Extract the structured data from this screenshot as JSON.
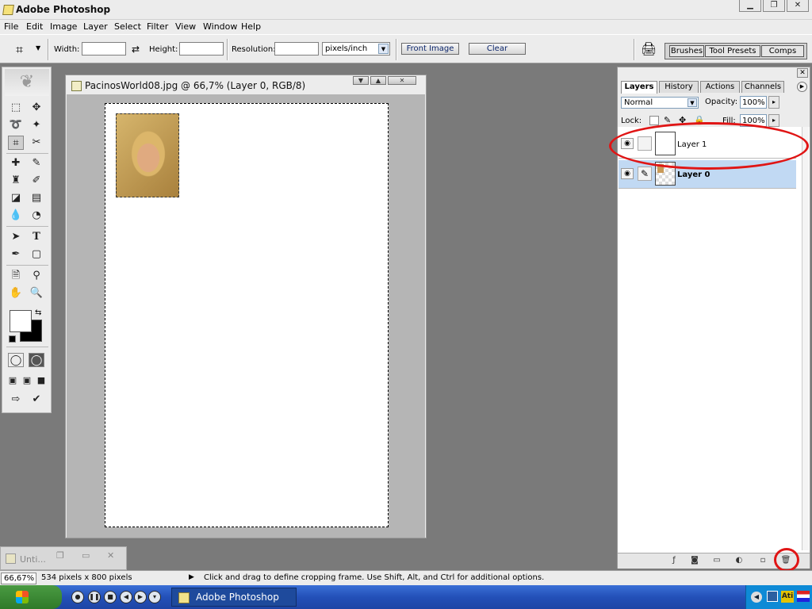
{
  "window": {
    "title": "Adobe Photoshop"
  },
  "menu": [
    "File",
    "Edit",
    "Image",
    "Layer",
    "Select",
    "Filter",
    "View",
    "Window",
    "Help"
  ],
  "options": {
    "width_label": "Width:",
    "width_value": "",
    "height_label": "Height:",
    "height_value": "",
    "resolution_label": "Resolution:",
    "resolution_value": "",
    "units": "pixels/inch",
    "front_image_label": "Front Image",
    "clear_label": "Clear",
    "well_tabs": [
      "Brushes",
      "Tool Presets",
      "Comps"
    ]
  },
  "document": {
    "title": "PacinosWorld08.jpg @ 66,7% (Layer 0, RGB/8)"
  },
  "minimized_doc": {
    "title": "Unti..."
  },
  "panel": {
    "tabs": [
      "Layers",
      "History",
      "Actions",
      "Channels"
    ],
    "active_tab": "Layers",
    "blend_mode": "Normal",
    "opacity_label": "Opacity:",
    "opacity_value": "100%",
    "lock_label": "Lock:",
    "fill_label": "Fill:",
    "fill_value": "100%",
    "layers": [
      {
        "name": "Layer 1",
        "visible": true,
        "selected": false
      },
      {
        "name": "Layer 0",
        "visible": true,
        "selected": true
      }
    ]
  },
  "status": {
    "zoom": "66,67%",
    "doc_info": "534 pixels x 800 pixels",
    "hint": "Click and drag to define cropping frame. Use Shift, Alt, and Ctrl for additional options."
  },
  "taskbar": {
    "start_label": "start",
    "item_label": "Adobe Photoshop"
  },
  "colors": {
    "accent_red": "#e01515",
    "selected_layer": "#c1d9f3",
    "taskbar_blue": "#245edb"
  }
}
